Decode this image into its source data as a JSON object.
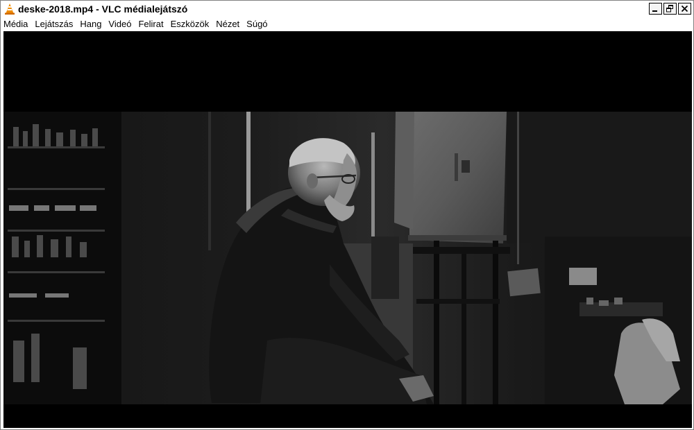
{
  "window": {
    "title": "deske-2018.mp4 - VLC médialejátszó",
    "icon": "vlc-cone-icon"
  },
  "window_controls": {
    "minimize": "minimize-icon",
    "restore": "restore-icon",
    "close": "close-icon"
  },
  "menu": {
    "items": [
      "Média",
      "Lejátszás",
      "Hang",
      "Videó",
      "Felirat",
      "Eszközök",
      "Nézet",
      "Súgó"
    ]
  },
  "video": {
    "scene": "video-frame",
    "letterbox_color": "#000000"
  },
  "colors": {
    "vlc_orange": "#f08c00",
    "background": "#ffffff"
  }
}
